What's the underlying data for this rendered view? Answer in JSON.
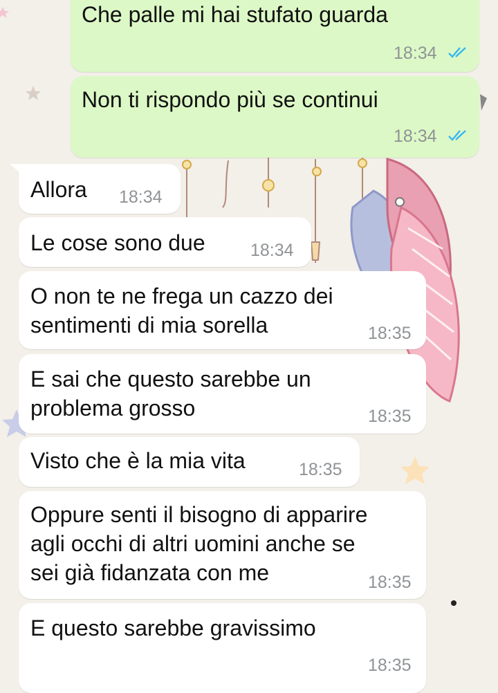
{
  "chat": {
    "outgoing": [
      {
        "text": "Che palle mi hai stufato guarda",
        "time": "18:34"
      },
      {
        "text": "Non ti rispondo più se continui",
        "time": "18:34"
      }
    ],
    "incoming": [
      {
        "lines": [
          "Allora"
        ],
        "time": "18:34"
      },
      {
        "lines": [
          "Le cose sono due"
        ],
        "time": "18:34"
      },
      {
        "lines": [
          "O non te ne frega un cazzo dei",
          "sentimenti di mia sorella"
        ],
        "time": "18:35"
      },
      {
        "lines": [
          "E sai che questo sarebbe un",
          "problema grosso"
        ],
        "time": "18:35"
      },
      {
        "lines": [
          "Visto che è la mia vita"
        ],
        "time": "18:35"
      },
      {
        "lines": [
          "Oppure senti il bisogno di apparire",
          "agli occhi di altri uomini anche se",
          "sei già fidanzata con me"
        ],
        "time": "18:35"
      },
      {
        "lines": [
          "E questo sarebbe gravissimo"
        ],
        "time": "18:35"
      }
    ]
  },
  "colors": {
    "outgoing_bubble": "#dcf8c6",
    "incoming_bubble": "#ffffff",
    "read_ticks": "#34b7f1",
    "timestamp": "#8f9396"
  },
  "icons": {
    "read_status": "double-check-icon",
    "wallpaper": "dreamcatcher-wallpaper"
  }
}
